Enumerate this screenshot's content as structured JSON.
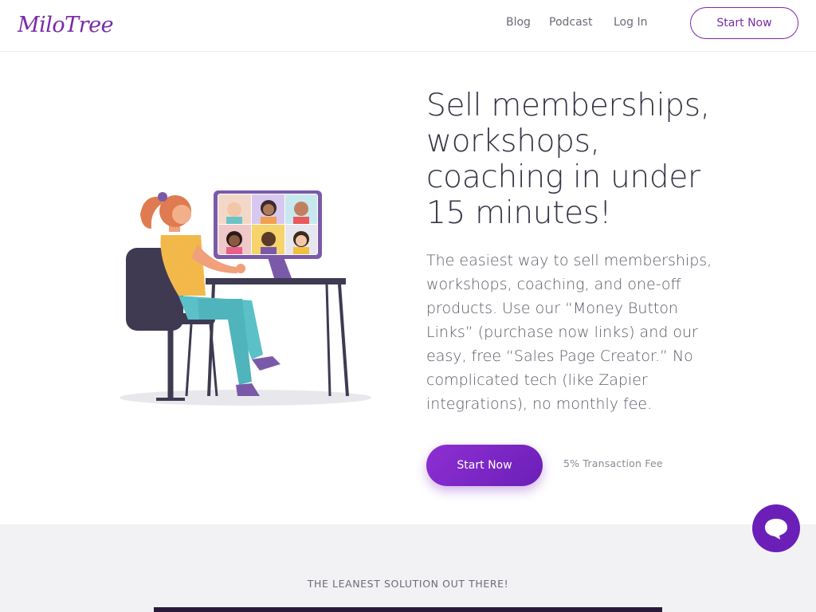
{
  "header": {
    "logo_text": "MiloTree",
    "nav": {
      "blog": "Blog",
      "podcast": "Podcast",
      "login": "Log In"
    },
    "cta_label": "Start Now"
  },
  "hero": {
    "title": "Sell memberships, workshops, coaching in under 15 minutes!",
    "description": "The easiest way to sell memberships, workshops, coaching, and one-off products. Use our “Money Button Links” (purchase now links) and our easy, free “Sales Page Creator.” No complicated tech (like Zapier integrations), no monthly fee.",
    "cta_label": "Start Now",
    "fee_note": "5% Transaction Fee",
    "illustration": "woman-at-desk-video-call-illustration"
  },
  "lower_section": {
    "caption": "THE LEANEST SOLUTION OUT THERE!"
  },
  "chat": {
    "icon": "chat-bubble-icon"
  },
  "colors": {
    "brand_purple": "#7a2aa8",
    "button_purple": "#8e2fd3",
    "text_dark": "#343446",
    "lower_bg": "#f2f2f5"
  }
}
